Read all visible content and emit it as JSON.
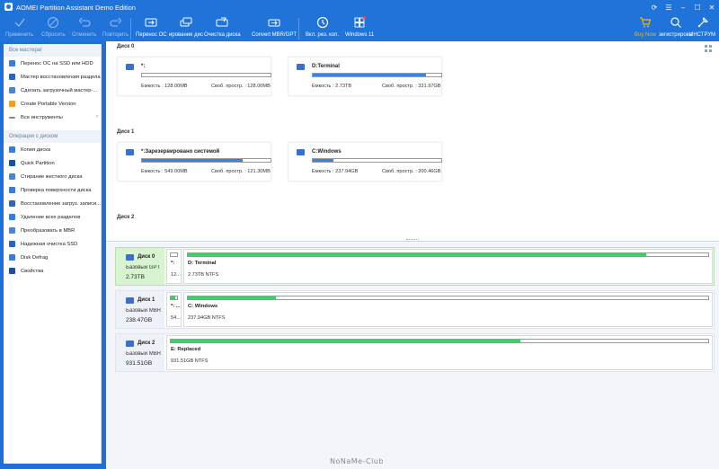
{
  "window": {
    "title": "AOMEI Partition Assistant Demo Edition"
  },
  "toolbar": {
    "items": [
      {
        "label": "Применить",
        "icon": "check-icon"
      },
      {
        "label": "Сбросить",
        "icon": "discard-icon"
      },
      {
        "label": "Отменить",
        "icon": "undo-icon"
      },
      {
        "label": "Повторить",
        "icon": "redo-icon"
      },
      {
        "label": "Перенос ОС",
        "icon": "migrate-os-icon"
      },
      {
        "label": "ирование дис",
        "icon": "clone-disk-icon"
      },
      {
        "label": "Очистка диска",
        "icon": "wipe-disk-icon"
      },
      {
        "label": "Convert MBR/GPT",
        "icon": "convert-icon"
      },
      {
        "label": "Вкл. рез. коп.",
        "icon": "backup-icon"
      },
      {
        "label": "Windows 11",
        "icon": "windows-icon"
      }
    ],
    "right_items": [
      {
        "label": "Buy Now",
        "icon": "cart-icon"
      },
      {
        "label": "зегистрирова",
        "icon": "key-icon"
      },
      {
        "label": "ИНСТРУМ",
        "icon": "tools-icon"
      }
    ]
  },
  "sidebar": {
    "wizards_header": "Все мастера!",
    "wizards": [
      {
        "label": "Перенос ОС на SSD или HDD"
      },
      {
        "label": "Мастер восстановления раздела"
      },
      {
        "label": "Сделать загрузочный мастер-..."
      },
      {
        "label": "Create Portable Version"
      },
      {
        "label": "Все инструменты"
      }
    ],
    "ops_header": "Операции с диском",
    "ops": [
      {
        "label": "Копия диска"
      },
      {
        "label": "Quick Partition"
      },
      {
        "label": "Стирание жесткого диска"
      },
      {
        "label": "Проверка поверхности диска"
      },
      {
        "label": "Восстановление загруз. записи..."
      },
      {
        "label": "Удаление всех разделов"
      },
      {
        "label": "Преобразовать в MBR"
      },
      {
        "label": "Надежная очистка SSD"
      },
      {
        "label": "Disk Defrag"
      },
      {
        "label": "Свойства"
      }
    ]
  },
  "top_view": {
    "disks": [
      {
        "title": "Диск 0",
        "partitions": [
          {
            "name": "*:",
            "fill": 0.0,
            "capacity": "Емкость : 128.00MB",
            "free": "Своб. простр. : 128.00MB"
          },
          {
            "name": "D:Terminal",
            "fill": 0.88,
            "capacity": "Емкость : 2.73TB",
            "free": "Своб. простр. : 331.97GB"
          }
        ]
      },
      {
        "title": "Диск 1",
        "partitions": [
          {
            "name": "*:Зарезервировано системой",
            "fill": 0.78,
            "capacity": "Емкость : 549.00MB",
            "free": "Своб. простр. : 121.30MB"
          },
          {
            "name": "C:Windows",
            "fill": 0.16,
            "capacity": "Емкость : 237.94GB",
            "free": "Своб. простр. : 200.46GB"
          }
        ]
      },
      {
        "title": "Диск 2",
        "partitions": []
      }
    ]
  },
  "bottom_view": {
    "disks": [
      {
        "name": "Диск 0",
        "type": "Базовый GPT",
        "size": "2.73TB",
        "segments": [
          {
            "name": "*:",
            "info": "12...",
            "fill": 0.0
          },
          {
            "name": "D: Terminal",
            "info": "2.73TB NTFS",
            "fill": 0.88
          }
        ]
      },
      {
        "name": "Диск 1",
        "type": "Базовый MBR",
        "size": "238.47GB",
        "segments": [
          {
            "name": "*: ...",
            "info": "54...",
            "fill": 0.78
          },
          {
            "name": "C: Windows",
            "info": "237.94GB NTFS",
            "fill": 0.17
          }
        ]
      },
      {
        "name": "Диск 2",
        "type": "Базовый MBR",
        "size": "931.51GB",
        "segments": [
          {
            "name": "E: Replaced",
            "info": "931.51GB NTFS",
            "fill": 0.65
          }
        ]
      }
    ]
  },
  "watermark": "NoNaMe-Club",
  "colors": {
    "accent": "#1f73d9",
    "used_blue": "#3c83de",
    "used_green": "#3fcf6a",
    "buy_now": "#f6b40e"
  }
}
